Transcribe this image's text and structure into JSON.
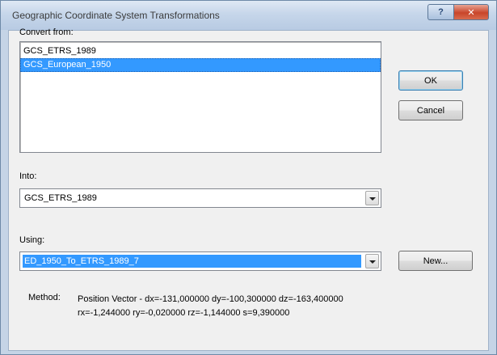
{
  "window": {
    "title": "Geographic Coordinate System Transformations",
    "help_label": "?",
    "close_label": "✕"
  },
  "convert_from": {
    "label": "Convert from:",
    "items": [
      {
        "label": "GCS_ETRS_1989",
        "selected": false
      },
      {
        "label": "GCS_European_1950",
        "selected": true
      }
    ]
  },
  "into": {
    "label": "Into:",
    "value": "GCS_ETRS_1989"
  },
  "using": {
    "label": "Using:",
    "value": "ED_1950_To_ETRS_1989_7"
  },
  "buttons": {
    "ok": "OK",
    "cancel": "Cancel",
    "new": "New..."
  },
  "method": {
    "label": "Method:",
    "line1": "Position Vector - dx=-131,000000 dy=-100,300000 dz=-163,400000",
    "line2": "rx=-1,244000 ry=-0,020000 rz=-1,144000 s=9,390000"
  },
  "colors": {
    "selection": "#3399ff",
    "title_bar": "#c6d6ea",
    "dialog_face": "#f0f0f0"
  }
}
